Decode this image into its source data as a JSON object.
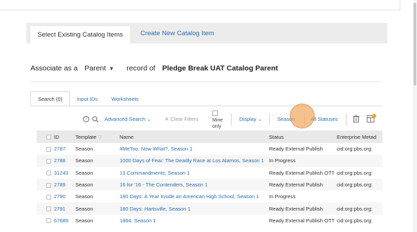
{
  "tabs": {
    "select_existing": "Select Existing Catalog Items",
    "create_new": "Create New Catalog Item"
  },
  "associate": {
    "label": "Associate as a",
    "selected": "Parent",
    "record_of": "record of",
    "record_name": "Pledge Break UAT Catalog Parent"
  },
  "subtabs": [
    "Search (0)",
    "Input IDs",
    "Worksheets"
  ],
  "toolbar": {
    "advanced_search": "Advanced Search",
    "clear_filters": "Clear Filters",
    "mine_only": "Mine only",
    "display": "Display",
    "season": "Season",
    "all_statuses": "All Statuses"
  },
  "table": {
    "headers": [
      "ID",
      "Template",
      "Name",
      "Status",
      "Enterprise Metad"
    ],
    "rows": [
      {
        "id": "2787",
        "template": "Season",
        "name": "#MeToo, Now What?, Season 1",
        "status": "Ready External Publish",
        "meta": "cid:org:pbs.org:"
      },
      {
        "id": "2788",
        "template": "Season",
        "name": "1000 Days of Fear: The Deadly Race at Los Alamos, Season 1",
        "status": "In Progress",
        "meta": ""
      },
      {
        "id": "31243",
        "template": "Season",
        "name": "13 Commandments, Season 1",
        "status": "Ready External Publish OTT",
        "meta": "cid:org:pbs.org:"
      },
      {
        "id": "2789",
        "template": "Season",
        "name": "16 for '16 - The Contenders, Season 1",
        "status": "Ready External Publish",
        "meta": "cid:org:pbs.org:"
      },
      {
        "id": "2790",
        "template": "Season",
        "name": "180 Days: A Year Inside an American High School, Season 1",
        "status": "In Progress",
        "meta": ""
      },
      {
        "id": "2791",
        "template": "Season",
        "name": "180 Days: Hartsville, Season 1",
        "status": "Ready External Publish",
        "meta": "cid:org:pbs.org:"
      },
      {
        "id": "67689",
        "template": "Season",
        "name": "1864, Season 1",
        "status": "Ready External Publish OTT",
        "meta": "cid:org:pbs.org:"
      }
    ]
  }
}
